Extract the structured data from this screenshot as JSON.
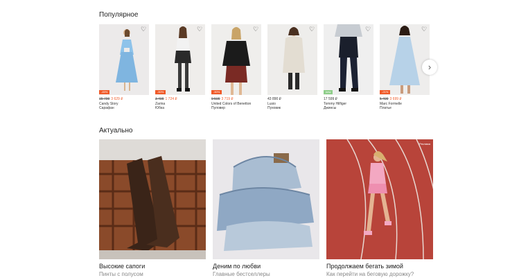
{
  "popular": {
    "title": "Популярное",
    "products": [
      {
        "badge": "-45%",
        "old_price": "15 799",
        "price": "3 629 ₽",
        "brand": "Candy Story",
        "kind": "Сарафан"
      },
      {
        "badge": "-50%",
        "old_price": "3 499",
        "price": "1 724 ₽",
        "brand": "Zarina",
        "kind": "Юбка"
      },
      {
        "badge": "-50%",
        "old_price": "9 599",
        "price": "3 719 ₽",
        "brand": "United Colors of Benetton",
        "kind": "Пуловер"
      },
      {
        "badge": "",
        "old_price": "",
        "price": "43 890 ₽",
        "brand": "Lusio",
        "kind": "Пуховик"
      },
      {
        "badge": "new",
        "old_price": "",
        "price": "17 599 ₽",
        "brand": "Tommy Hilfiger",
        "kind": "Джинсы"
      },
      {
        "badge": "-21%",
        "old_price": "5 499",
        "price": "3 699 ₽",
        "brand": "Marc Formelle",
        "kind": "Платье"
      }
    ],
    "heart_icon": "heart-icon",
    "next_icon": "chevron-right-icon",
    "next_glyph": "›",
    "heart_glyph": "♡"
  },
  "actual": {
    "title": "Актуально",
    "tiles": [
      {
        "title": "Высокие сапоги",
        "subtitle": "Пинты с полусом"
      },
      {
        "title": "Деним по любви",
        "subtitle": "Главные бестселлеры"
      },
      {
        "title": "Продолжаем бегать зимой",
        "subtitle": "Как перейти на беговую дорожку?",
        "ad": "Реклама"
      }
    ]
  },
  "colors": {
    "sale": "#f05a28",
    "new_badge": "#8fce8a",
    "text": "#222222",
    "muted": "#888888"
  }
}
